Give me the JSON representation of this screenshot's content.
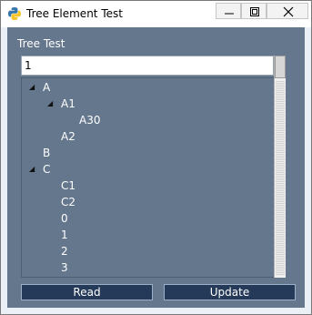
{
  "window": {
    "title": "Tree Element Test"
  },
  "tree_section": {
    "label": "Tree Test",
    "input_value": "1",
    "nodes": [
      {
        "text": "A",
        "expanded": true
      },
      {
        "text": "A1",
        "expanded": true
      },
      {
        "text": "A30"
      },
      {
        "text": "A2"
      },
      {
        "text": "B"
      },
      {
        "text": "C",
        "expanded": true
      },
      {
        "text": "C1"
      },
      {
        "text": "C2"
      },
      {
        "text": "0"
      },
      {
        "text": "1"
      },
      {
        "text": "2"
      },
      {
        "text": "3"
      }
    ]
  },
  "buttons": {
    "read": "Read",
    "update": "Update"
  }
}
